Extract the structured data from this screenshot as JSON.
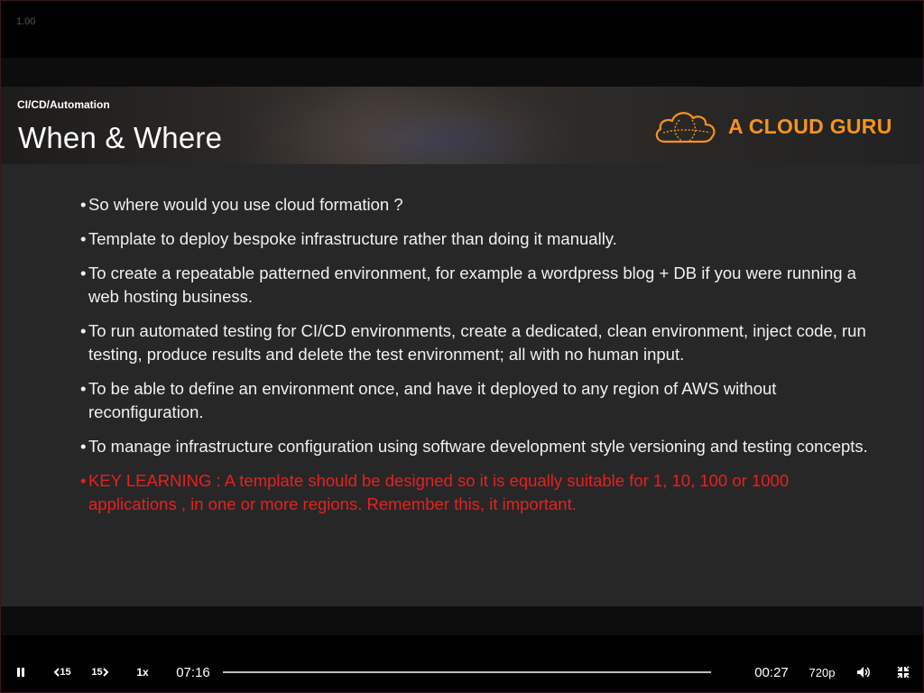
{
  "player": {
    "version_label": "1.00",
    "controls": {
      "rewind_label": "15",
      "forward_label": "15",
      "speed_label": "1x",
      "current_time": "07:16",
      "remaining_time": "00:27",
      "quality_label": "720p",
      "progress_fraction": 0.0
    },
    "icons": {
      "pause": "pause-icon",
      "rewind": "rewind-15-icon",
      "forward": "forward-15-icon",
      "volume": "volume-icon",
      "fullscreen": "exit-fullscreen-icon"
    }
  },
  "slide": {
    "section": "CI/CD/Automation",
    "title": "When & Where",
    "brand": "A CLOUD GURU",
    "brand_color": "#f7931e",
    "key_color": "#e8201e",
    "bullets": [
      "So where would you use cloud formation ?",
      "Template to deploy bespoke infrastructure rather than doing it manually.",
      "To create a repeatable patterned environment, for example a wordpress blog + DB if you were running a web hosting business.",
      "To run automated testing for CI/CD environments, create a dedicated, clean environment, inject code, run testing, produce results and delete the test environment; all with no human input.",
      "To be able to define an environment once, and have it deployed to any region of AWS without reconfiguration.",
      "To manage infrastructure configuration using software development style versioning and testing concepts.",
      "KEY LEARNING : A template should be designed so it is equally suitable for 1, 10, 100 or 1000 applications , in one or more regions. Remember this, it important."
    ]
  }
}
